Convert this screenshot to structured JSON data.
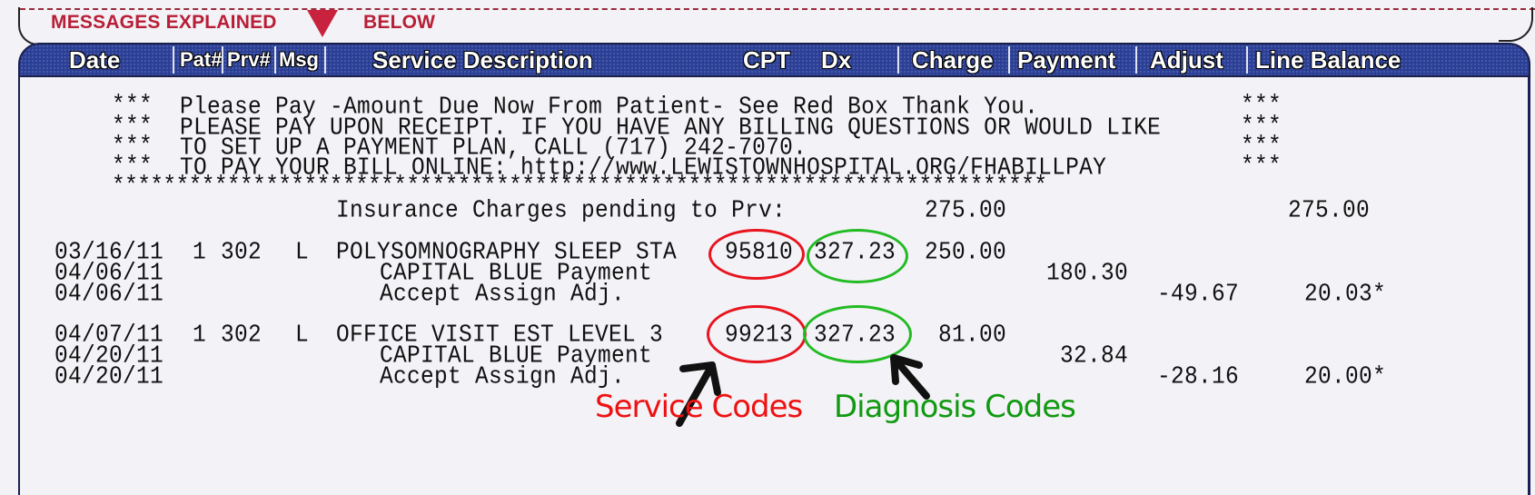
{
  "banner": {
    "left_text": "MESSAGES EXPLAINED",
    "right_text": "BELOW",
    "indicator_icon": "red-down-triangle"
  },
  "columns": [
    {
      "key": "date",
      "label": "Date"
    },
    {
      "key": "pat",
      "label": "Pat#"
    },
    {
      "key": "prv",
      "label": "Prv#"
    },
    {
      "key": "msg",
      "label": "Msg"
    },
    {
      "key": "desc",
      "label": "Service Description"
    },
    {
      "key": "cpt",
      "label": "CPT"
    },
    {
      "key": "dx",
      "label": "Dx"
    },
    {
      "key": "charge",
      "label": "Charge"
    },
    {
      "key": "payment",
      "label": "Payment"
    },
    {
      "key": "adjust",
      "label": "Adjust"
    },
    {
      "key": "balance",
      "label": "Line Balance"
    }
  ],
  "notice": {
    "marker": "***",
    "lines": [
      "Please Pay -Amount Due Now From Patient- See Red Box Thank You.",
      "PLEASE PAY UPON RECEIPT. IF YOU HAVE ANY BILLING QUESTIONS OR WOULD LIKE",
      "TO SET UP A PAYMENT PLAN, CALL (717) 242-7070.",
      "TO PAY YOUR BILL ONLINE: http://www.LEWISTOWNHOSPITAL.ORG/FHABILLPAY"
    ],
    "rule": "*************************************************************************"
  },
  "pending": {
    "label": "Insurance Charges pending to Prv:",
    "charge": "275.00",
    "balance": "275.00"
  },
  "services": [
    {
      "date": "03/16/11",
      "pat": "1",
      "prv": "302",
      "msg": "L",
      "description": "POLYSOMNOGRAPHY SLEEP STA",
      "cpt": "95810",
      "dx": "327.23",
      "charge": "250.00",
      "transactions": [
        {
          "date": "04/06/11",
          "description": "CAPITAL BLUE Payment",
          "payment": "180.30"
        },
        {
          "date": "04/06/11",
          "description": "Accept Assign Adj.",
          "adjust": "-49.67",
          "balance": "20.03*"
        }
      ]
    },
    {
      "date": "04/07/11",
      "pat": "1",
      "prv": "302",
      "msg": "L",
      "description": "OFFICE VISIT EST LEVEL 3",
      "cpt": "99213",
      "dx": "327.23",
      "charge": "81.00",
      "transactions": [
        {
          "date": "04/20/11",
          "description": "CAPITAL BLUE Payment",
          "payment": "32.84"
        },
        {
          "date": "04/20/11",
          "description": "Accept Assign Adj.",
          "adjust": "-28.16",
          "balance": "20.00*"
        }
      ]
    }
  ],
  "annotations": {
    "service_codes": {
      "label": "Service Codes",
      "color": "#ee1111"
    },
    "diagnosis_codes": {
      "label": "Diagnosis Codes",
      "color": "#119911"
    }
  },
  "colors": {
    "header_bg": "#2b3f96",
    "banner_text": "#b81e36",
    "service_oval": "#e8141e",
    "diagnosis_oval": "#22bb22"
  }
}
